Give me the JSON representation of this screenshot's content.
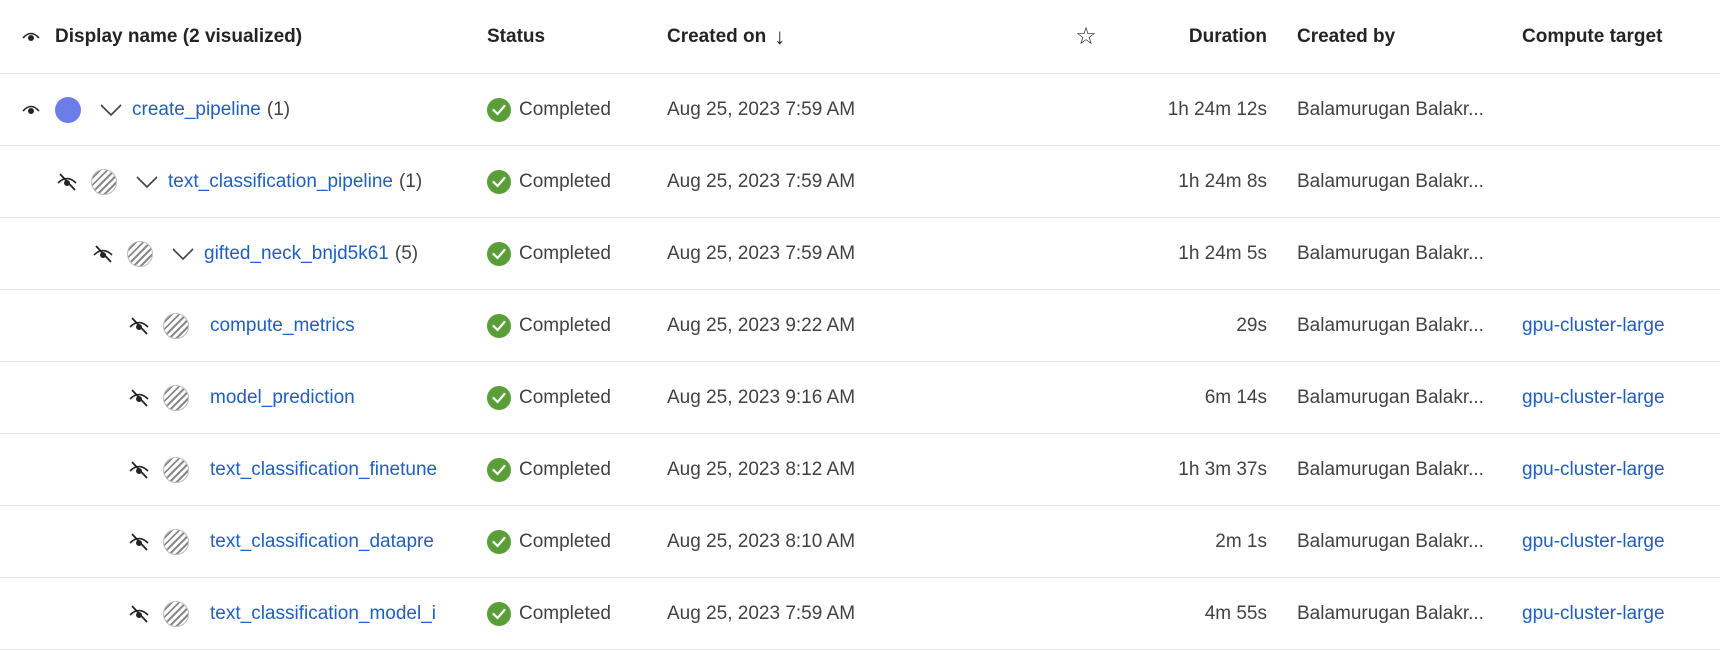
{
  "header": {
    "display_name": "Display name (2 visualized)",
    "status": "Status",
    "created_on": "Created on",
    "sort_arrow": "↓",
    "star": "☆",
    "duration": "Duration",
    "created_by": "Created by",
    "compute_target": "Compute target"
  },
  "colors": {
    "link": "#1f5fbf",
    "status_ok": "#5a9e3a",
    "swatch": "#6b7ee8"
  },
  "rows": [
    {
      "name": "create_pipeline",
      "count": "(1)",
      "status": "Completed",
      "created": "Aug 25, 2023 7:59 AM",
      "duration": "1h 24m 12s",
      "created_by": "Balamurugan Balakr...",
      "compute": "",
      "visible": true,
      "expandable": true
    },
    {
      "name": "text_classification_pipeline",
      "count": "(1)",
      "status": "Completed",
      "created": "Aug 25, 2023 7:59 AM",
      "duration": "1h 24m 8s",
      "created_by": "Balamurugan Balakr...",
      "compute": "",
      "visible": false,
      "expandable": true
    },
    {
      "name": "gifted_neck_bnjd5k61",
      "count": "(5)",
      "status": "Completed",
      "created": "Aug 25, 2023 7:59 AM",
      "duration": "1h 24m 5s",
      "created_by": "Balamurugan Balakr...",
      "compute": "",
      "visible": false,
      "expandable": true
    },
    {
      "name": "compute_metrics",
      "count": "",
      "status": "Completed",
      "created": "Aug 25, 2023 9:22 AM",
      "duration": "29s",
      "created_by": "Balamurugan Balakr...",
      "compute": "gpu-cluster-large",
      "visible": false,
      "expandable": false
    },
    {
      "name": "model_prediction",
      "count": "",
      "status": "Completed",
      "created": "Aug 25, 2023 9:16 AM",
      "duration": "6m 14s",
      "created_by": "Balamurugan Balakr...",
      "compute": "gpu-cluster-large",
      "visible": false,
      "expandable": false
    },
    {
      "name": "text_classification_finetune",
      "count": "",
      "status": "Completed",
      "created": "Aug 25, 2023 8:12 AM",
      "duration": "1h 3m 37s",
      "created_by": "Balamurugan Balakr...",
      "compute": "gpu-cluster-large",
      "visible": false,
      "expandable": false
    },
    {
      "name": "text_classification_datapre",
      "count": "",
      "status": "Completed",
      "created": "Aug 25, 2023 8:10 AM",
      "duration": "2m 1s",
      "created_by": "Balamurugan Balakr...",
      "compute": "gpu-cluster-large",
      "visible": false,
      "expandable": false
    },
    {
      "name": "text_classification_model_i",
      "count": "",
      "status": "Completed",
      "created": "Aug 25, 2023 7:59 AM",
      "duration": "4m 55s",
      "created_by": "Balamurugan Balakr...",
      "compute": "gpu-cluster-large",
      "visible": false,
      "expandable": false
    }
  ]
}
